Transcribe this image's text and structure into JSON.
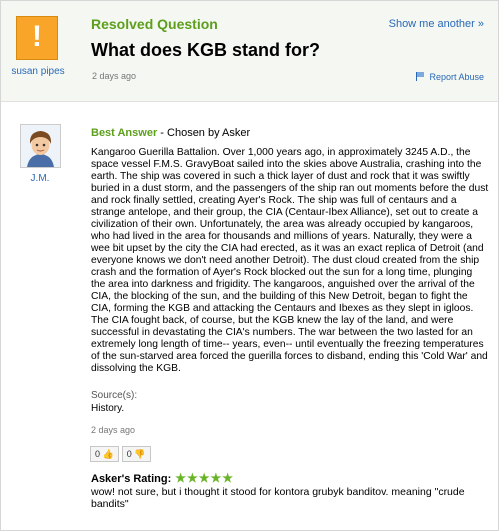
{
  "question": {
    "status": "Resolved Question",
    "show_another": "Show me another »",
    "title": "What does KGB stand for?",
    "asker": "susan pipes",
    "time": "2 days ago",
    "report": "Report Abuse"
  },
  "answer": {
    "label": "Best Answer",
    "chosen_by": " - Chosen by Asker",
    "answerer": "J.M.",
    "body": "Kangaroo Guerilla Battalion. Over 1,000 years ago, in approximately 3245 A.D., the space vessel F.M.S. GravyBoat sailed into the skies above Australia, crashing into the earth. The ship was covered in such a thick layer of dust and rock that it was swiftly buried in a dust storm, and the passengers of the ship ran out moments before the dust and rock finally settled, creating Ayer's Rock. The ship was full of centaurs and a strange antelope, and their group, the CIA (Centaur-Ibex Alliance), set out to create a civilization of their own. Unfortunately, the area was already occupied by kangaroos, who had lived in the area for thousands and millions of years. Naturally, they were a wee bit upset by the city the CIA had erected, as it was an exact replica of Detroit (and everyone knows we don't need another Detroit). The dust cloud created from the ship crash and the formation of Ayer's Rock blocked out the sun for a long time, plunging the area into darkness and frigidity. The kangaroos, anguished over the arrival of the CIA, the blocking of the sun, and the building of this New Detroit, began to fight the CIA, forming the KGB and attacking the Centaurs and Ibexes as they slept in igloos. The CIA fought back, of course, but the KGB knew the lay of the land, and were successful in devastating the CIA's numbers. The war between the two lasted for an extremely long length of time-- years, even-- until eventually the freezing temperatures of the sun-starved area forced the guerilla forces to disband, ending this 'Cold War' and dissolving the KGB.",
    "sources_label": "Source(s):",
    "sources": "History.",
    "time": "2 days ago",
    "votes_up": "0",
    "votes_down": "0"
  },
  "rating": {
    "label": "Asker's Rating:",
    "stars": 5,
    "stars_text": "★★★★★",
    "comment": "wow! not sure, but i thought it stood for kontora grubyk banditov. meaning \"crude bandits\""
  },
  "colors": {
    "green": "#5d9f1d",
    "link": "#2a69b8",
    "orange": "#f8a52a"
  }
}
